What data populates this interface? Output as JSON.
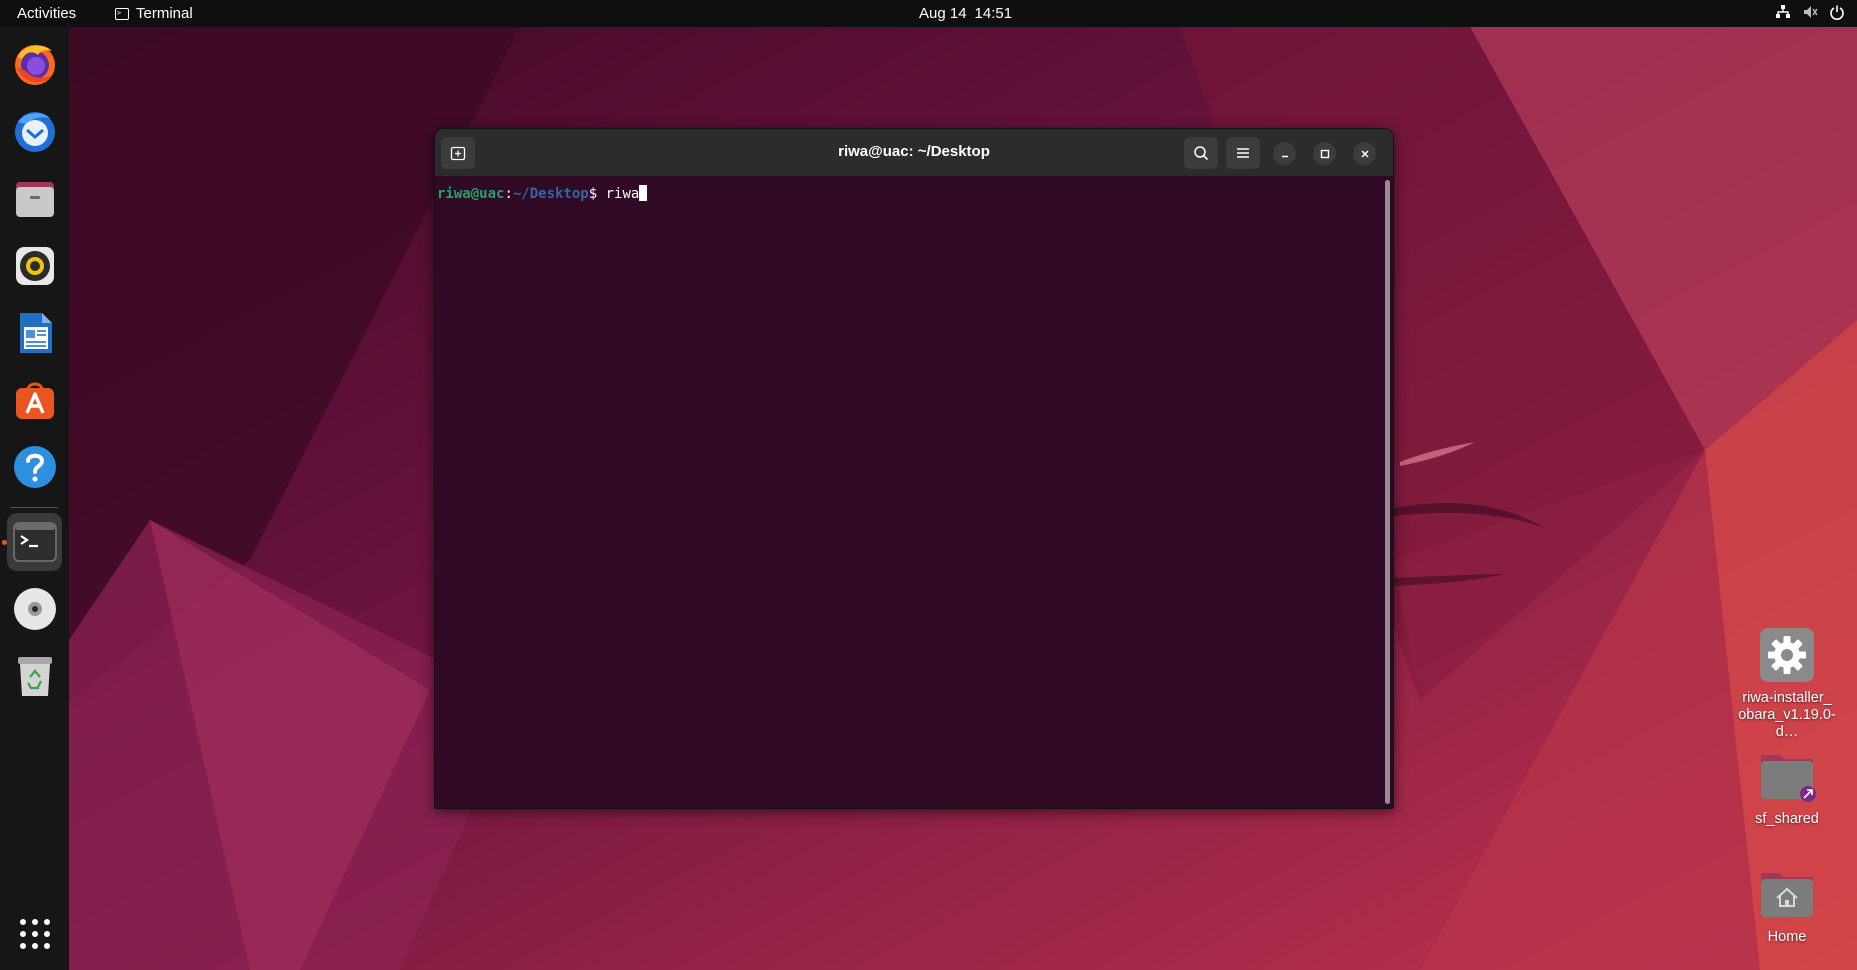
{
  "topbar": {
    "activities": "Activities",
    "app_name": "Terminal",
    "date": "Aug 14",
    "time": "14:51",
    "tray_icons": [
      "network-icon",
      "volume-muted-icon",
      "power-icon"
    ]
  },
  "dock": {
    "apps": [
      {
        "name": "firefox-icon"
      },
      {
        "name": "thunderbird-icon"
      },
      {
        "name": "files-icon"
      },
      {
        "name": "rhythmbox-icon"
      },
      {
        "name": "libreoffice-writer-icon"
      },
      {
        "name": "app-center-icon"
      },
      {
        "name": "help-icon"
      },
      {
        "name": "terminal-icon",
        "active": true
      },
      {
        "name": "disc-icon"
      },
      {
        "name": "trash-icon"
      }
    ],
    "show_apps_icon": "grid-icon"
  },
  "desktop": {
    "icons": [
      {
        "label": "riwa-installer_\nobara_v1.19.0-d…",
        "icon": "gear-icon"
      },
      {
        "label": "sf_shared",
        "icon": "folder-link-icon"
      },
      {
        "label": "Home",
        "icon": "home-folder-icon"
      }
    ]
  },
  "terminal": {
    "title": "riwa@uac: ~/Desktop",
    "prompt_user": "riwa@uac",
    "prompt_sep": ":",
    "prompt_path": "~/Desktop",
    "prompt_symbol": "$ ",
    "command": "riwa"
  },
  "colors": {
    "topbar": "#0f0f0f",
    "dock": "#161616",
    "terminal_bg": "#300a24",
    "terminal_header": "#2c2c2c",
    "prompt_user": "#26a269",
    "prompt_path": "#3465a4",
    "ubuntu_orange": "#e95420"
  }
}
